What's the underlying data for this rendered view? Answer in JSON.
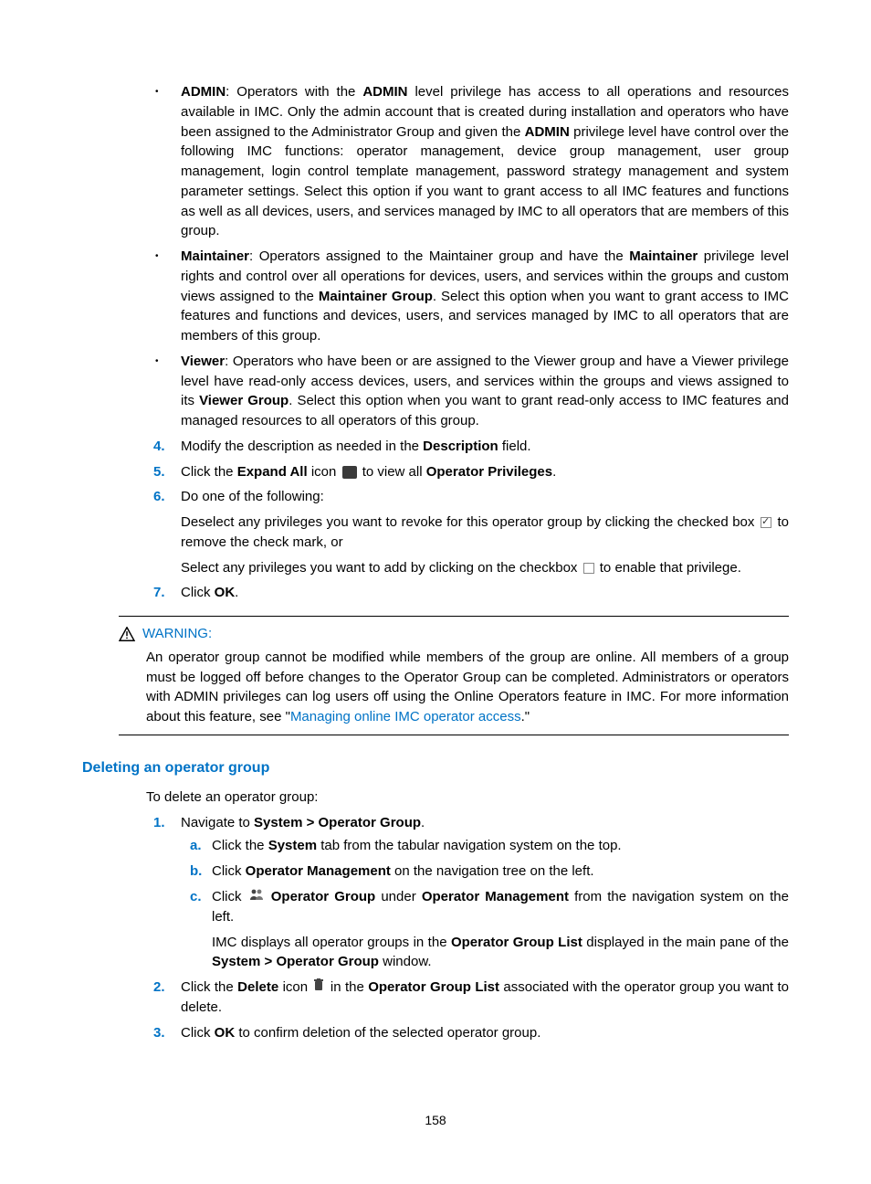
{
  "bullets": {
    "admin": {
      "lead": "ADMIN",
      "text1": ": Operators with the ",
      "b1": "ADMIN",
      "text2": " level privilege has access to all operations and resources available in IMC. Only the admin account that is created during installation and operators who have been assigned to the Administrator Group and given the ",
      "b2": "ADMIN",
      "text3": " privilege level have control over the following IMC functions: operator management, device group management, user group management, login control template management, password strategy management and system parameter settings. Select this option if you want to grant access to all IMC features and functions as well as all devices, users, and services managed by IMC to all operators that are members of this group."
    },
    "maintainer": {
      "lead": "Maintainer",
      "text1": ": Operators assigned to the Maintainer group and have the ",
      "b1": "Maintainer",
      "text2": " privilege level rights and control over all operations for devices, users, and services within the groups and custom views assigned to the ",
      "b2": "Maintainer Group",
      "text3": ". Select this option when you want to grant access to IMC features and functions and devices, users, and services managed by IMC to all operators that are members of this group."
    },
    "viewer": {
      "lead": "Viewer",
      "text1": ": Operators who have been or are assigned to the Viewer group and have a Viewer privilege level have read-only access devices, users, and services within the groups and views assigned to its ",
      "b1": "Viewer Group",
      "text2": ". Select this option when you want to grant read-only access to IMC features and managed resources to all operators of this group."
    }
  },
  "steps": {
    "s4": {
      "n": "4.",
      "t1": "Modify the description as needed in the ",
      "b1": "Description",
      "t2": " field."
    },
    "s5": {
      "n": "5.",
      "t1": "Click the ",
      "b1": "Expand All",
      "t2": " icon ",
      "t3": " to view all ",
      "b2": "Operator Privileges",
      "t4": "."
    },
    "s6": {
      "n": "6.",
      "t1": "Do one of the following:",
      "p1a": "Deselect any privileges you want to revoke for this operator group by clicking the checked box ",
      "p1b": " to remove the check mark, or",
      "p2a": "Select any privileges you want to add by clicking on the checkbox ",
      "p2b": " to enable that privilege."
    },
    "s7": {
      "n": "7.",
      "t1": "Click ",
      "b1": "OK",
      "t2": "."
    }
  },
  "warning": {
    "label": "WARNING:",
    "body1": "An operator group cannot be modified while members of the group are online. All members of a group must be logged off before changes to the Operator Group can be completed. Administrators or operators with ADMIN privileges can log users off using the Online Operators feature in IMC. For more information about this feature, see \"",
    "link": "Managing online IMC operator access",
    "body2": ".\""
  },
  "section": {
    "heading": "Deleting an operator group",
    "intro": "To delete an operator group:",
    "d1": {
      "n": "1.",
      "t1": "Navigate to ",
      "b1": "System > Operator Group",
      "t2": ".",
      "a": {
        "sn": "a.",
        "t1": "Click the ",
        "b1": "System",
        "t2": " tab from the tabular navigation system on the top."
      },
      "b": {
        "sn": "b.",
        "t1": "Click ",
        "b1": "Operator Management",
        "t2": " on the navigation tree on the left."
      },
      "c": {
        "sn": "c.",
        "t1": "Click ",
        "b1": "Operator Group",
        "t2": " under ",
        "b2": "Operator Management",
        "t3": " from the navigation system on the left.",
        "p1": "IMC displays all operator groups in the ",
        "pb1": "Operator Group List",
        "p2": " displayed in the main pane of the ",
        "pb2": "System > Operator Group",
        "p3": " window."
      }
    },
    "d2": {
      "n": "2.",
      "t1": "Click the ",
      "b1": "Delete",
      "t2": " icon ",
      "t3": " in the ",
      "b2": "Operator Group List",
      "t4": " associated with the operator group you want to delete."
    },
    "d3": {
      "n": "3.",
      "t1": "Click ",
      "b1": "OK",
      "t2": " to confirm deletion of the selected operator group."
    }
  },
  "pageNumber": "158"
}
